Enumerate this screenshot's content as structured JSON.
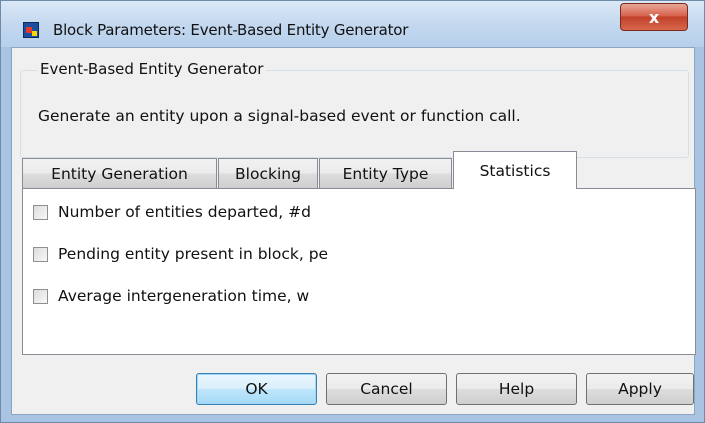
{
  "window": {
    "title": "Block Parameters: Event-Based Entity Generator",
    "close_glyph": "x"
  },
  "group": {
    "title": "Event-Based Entity Generator",
    "description": "Generate an entity upon a signal-based event or function call."
  },
  "tabs": [
    {
      "label": "Entity Generation",
      "active": false
    },
    {
      "label": "Blocking",
      "active": false
    },
    {
      "label": "Entity Type",
      "active": false
    },
    {
      "label": "Statistics",
      "active": true
    }
  ],
  "statistics": [
    {
      "label": "Number of entities departed, #d",
      "checked": false
    },
    {
      "label": "Pending entity present in block, pe",
      "checked": false
    },
    {
      "label": "Average intergeneration time, w",
      "checked": false
    }
  ],
  "buttons": {
    "ok": "OK",
    "cancel": "Cancel",
    "help": "Help",
    "apply": "Apply"
  },
  "colors": {
    "title_bar": "#c3d8ef",
    "close_button": "#c2412a",
    "default_button": "#bee6fd"
  }
}
